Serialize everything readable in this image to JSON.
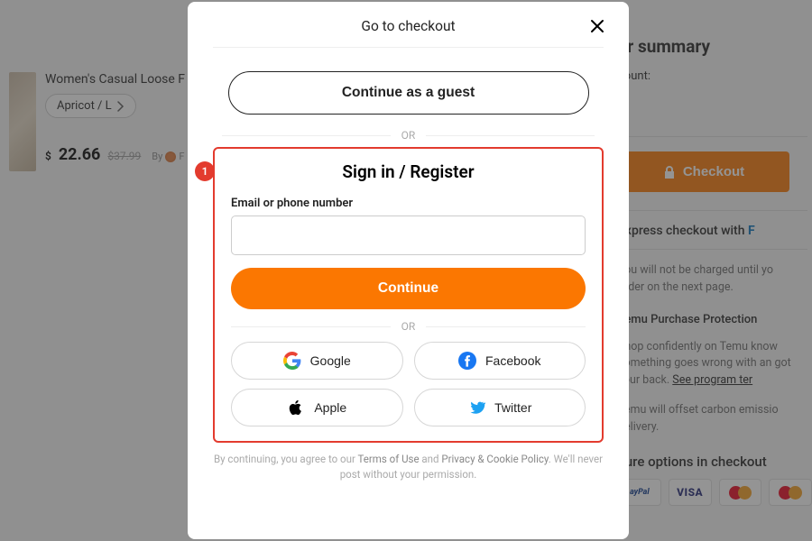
{
  "cart": {
    "product_title": "Women's Casual Loose F",
    "variant": "Apricot / L",
    "price_currency": "$",
    "price": "22.66",
    "price_old": "$37.99",
    "by_prefix": "By",
    "by_seller_initial": "F"
  },
  "summary": {
    "title": "er summary",
    "count_label": "count:",
    "checkout_label": "Checkout",
    "express_prefix": "Express checkout with",
    "charge_note": "You will not be charged until yo",
    "charge_note2": "order on the next page.",
    "protection_title": "Temu Purchase Protection",
    "protection_body": "Shop confidently on Temu know something goes wrong with an got your back. ",
    "protection_link": "See program ter",
    "offset_note": "Temu will offset carbon emissio delivery.",
    "secure_title": "cure options in checkout",
    "pay": {
      "paypal": "ayPal",
      "visa": "VISA"
    }
  },
  "modal": {
    "title": "Go to checkout",
    "guest_label": "Continue as a guest",
    "or": "OR",
    "signin_title": "Sign in / Register",
    "badge": "1",
    "field_label": "Email or phone number",
    "continue_label": "Continue",
    "social": {
      "google": "Google",
      "facebook": "Facebook",
      "apple": "Apple",
      "twitter": "Twitter"
    },
    "fine_pre": "By continuing, you agree to our ",
    "fine_terms": "Terms of Use",
    "fine_and": " and ",
    "fine_privacy": "Privacy & Cookie Policy",
    "fine_post": ". We'll never post without your permission."
  }
}
